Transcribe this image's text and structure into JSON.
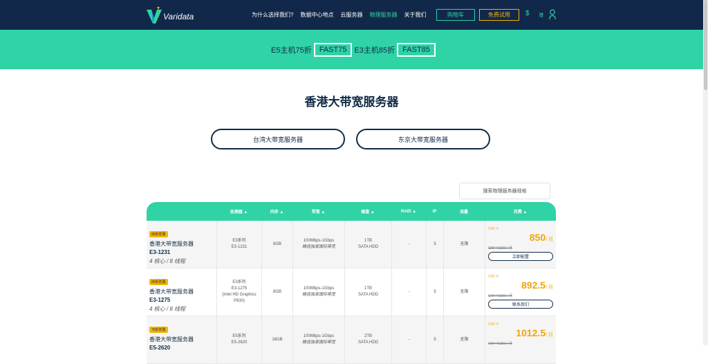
{
  "nav": {
    "logo_text": "Varidata",
    "menu": [
      "为什么选择我们?",
      "数据中心地点",
      "云服务器",
      "物理服务器",
      "关于我们"
    ],
    "cart": "购物车",
    "trial": "免费试用",
    "currency": "$",
    "lang": "港"
  },
  "promo": {
    "e5_text": "E5主机75折",
    "e5_code": "FAST75",
    "e3_text": "E3主机85折",
    "e3_code": "FAST85"
  },
  "page": {
    "title": "香港大带宽服务器",
    "tab_taiwan": "台湾大带宽服务器",
    "tab_tokyo": "东京大带宽服务器",
    "search_placeholder": "搜索物理服务器规格"
  },
  "table": {
    "headers": [
      "处理器 ▲",
      "内存 ▲",
      "带宽 ▲",
      "硬盘 ▲",
      "RAID ▲",
      "IP",
      "流量",
      "月费 ▲"
    ],
    "rows": [
      {
        "badge": "85折优惠",
        "name": "香港大带宽服务器",
        "model": "E3-1231",
        "cores": "4 核心 / 8 线程",
        "cpu": [
          "E3系列",
          "E3-1231"
        ],
        "ram": "8GB",
        "bw": [
          "100Mbps-1Gbps",
          "精选独享国际带宽"
        ],
        "disk": [
          "1TB",
          "SATA HDD"
        ],
        "raid": "-",
        "ip": "5",
        "traffic": "无限",
        "cny": "CNY ¥",
        "price": "850",
        "unit": "/ 月",
        "old": "CNY ¥1000 / 月",
        "action": "立即配置"
      },
      {
        "badge": "85折优惠",
        "name": "香港大带宽服务器",
        "model": "E3-1275",
        "cores": "4 核心 / 8 线程",
        "cpu": [
          "E3系列",
          "E3-1275",
          "(Intel HD Graphics",
          "P630)"
        ],
        "ram": "8GB",
        "bw": [
          "100Mbps-1Gbps",
          "精选独享国际带宽"
        ],
        "disk": [
          "1TB",
          "SATA HDD"
        ],
        "raid": "-",
        "ip": "5",
        "traffic": "无限",
        "cny": "CNY ¥",
        "price": "892.5",
        "unit": "/ 月",
        "old": "CNY ¥1050 / 月",
        "action": "联系我们"
      },
      {
        "badge": "75折优惠",
        "name": "香港大带宽服务器",
        "model": "E5-2620",
        "cores": "",
        "cpu": [
          "E5系列",
          "E5-2620"
        ],
        "ram": "16GB",
        "bw": [
          "100Mbps-1Gbps",
          "精选独享国际带宽"
        ],
        "disk": [
          "2TB",
          "SATA HDD"
        ],
        "raid": "-",
        "ip": "5",
        "traffic": "无限",
        "cny": "CNY ¥",
        "price": "1012.5",
        "unit": "/ 月",
        "old": "CNY ¥1350 / 月",
        "action": ""
      }
    ]
  },
  "colors": {
    "navy": "#12284a",
    "teal": "#2fd3a6",
    "orange": "#f5a300",
    "yellow": "#f5b400"
  }
}
